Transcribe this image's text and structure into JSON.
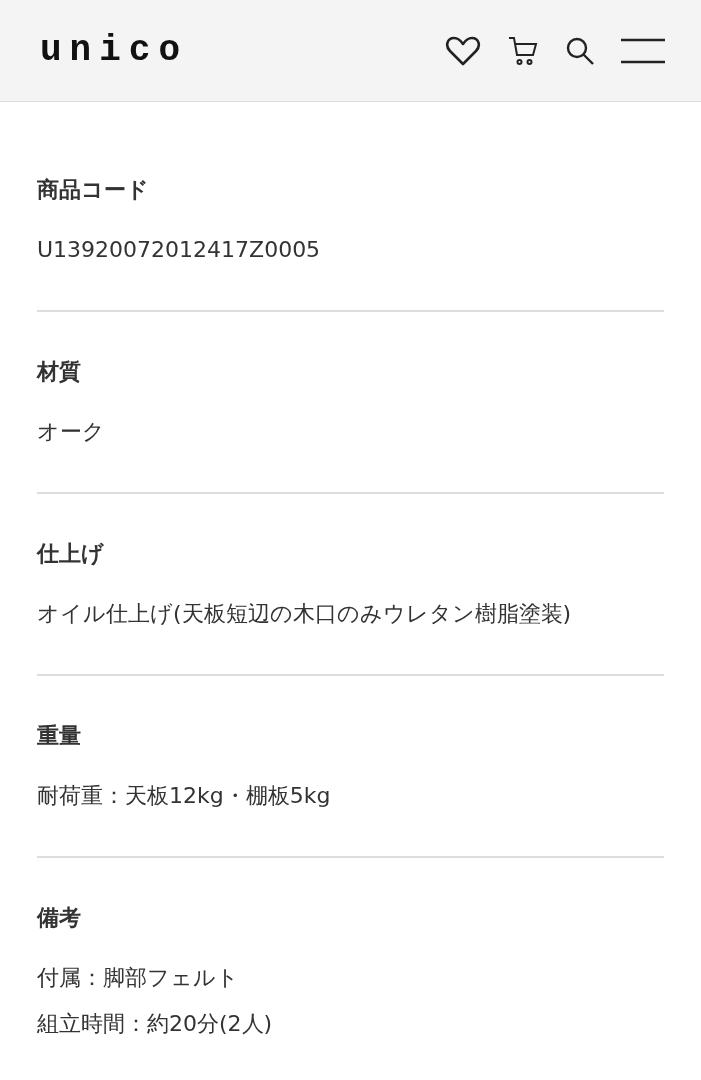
{
  "header": {
    "logo": "unico"
  },
  "specs": [
    {
      "label": "商品コード",
      "lines": [
        "U13920072012417Z0005"
      ]
    },
    {
      "label": "材質",
      "lines": [
        "オーク"
      ]
    },
    {
      "label": "仕上げ",
      "lines": [
        "オイル仕上げ(天板短辺の木口のみウレタン樹脂塗装)"
      ]
    },
    {
      "label": "重量",
      "lines": [
        "耐荷重：天板12kg・棚板5kg"
      ]
    },
    {
      "label": "備考",
      "lines": [
        "付属：脚部フェルト",
        "組立時間：約20分(2人)"
      ]
    }
  ]
}
